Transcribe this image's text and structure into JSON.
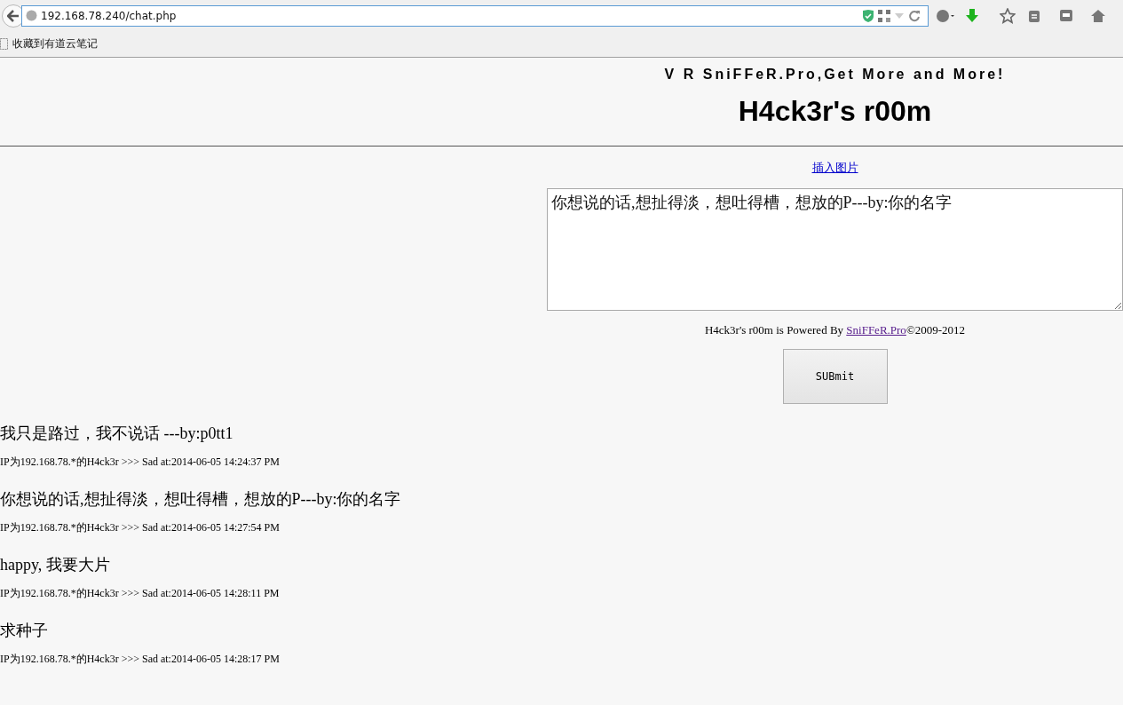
{
  "browser": {
    "url": "192.168.78.240/chat.php",
    "bookmarks": [
      "收藏到有道云笔记"
    ]
  },
  "header": {
    "tagline": "V R SniFFeR.Pro,Get More and More!",
    "title": "H4ck3r's r00m"
  },
  "composer": {
    "insert_link": "插入图片",
    "value": "你想说的话,想扯得淡，想吐得槽，想放的P---by:你的名字",
    "credit_before": "H4ck3r's r00m is Powered By ",
    "credit_link": "SniFFeR.Pro",
    "credit_after": "©2009-2012",
    "submit": "SUBmit"
  },
  "messages": [
    {
      "text": "我只是路过，我不说话 ---by:p0tt1",
      "meta": "IP为192.168.78.*的H4ck3r >>> Sad at:2014-06-05 14:24:37 PM"
    },
    {
      "text": "你想说的话,想扯得淡，想吐得槽，想放的P---by:你的名字",
      "meta": "IP为192.168.78.*的H4ck3r >>> Sad at:2014-06-05 14:27:54 PM"
    },
    {
      "text": "happy, 我要大片",
      "meta": "IP为192.168.78.*的H4ck3r >>> Sad at:2014-06-05 14:28:11 PM"
    },
    {
      "text": "求种子",
      "meta": "IP为192.168.78.*的H4ck3r >>> Sad at:2014-06-05 14:28:17 PM"
    }
  ]
}
